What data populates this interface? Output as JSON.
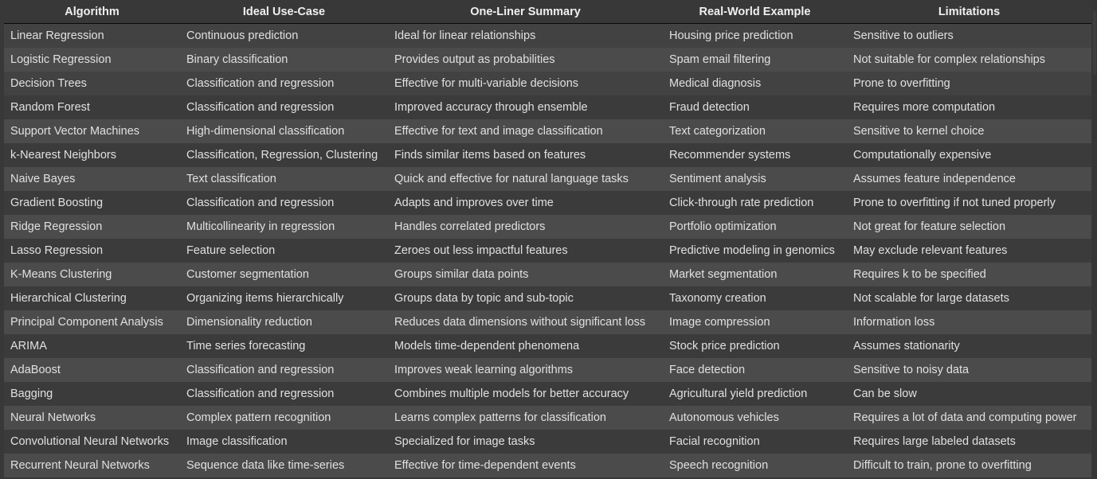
{
  "table": {
    "headers": [
      "Algorithm",
      "Ideal Use-Case",
      "One-Liner Summary",
      "Real-World Example",
      "Limitations"
    ],
    "rows": [
      [
        "Linear Regression",
        "Continuous prediction",
        "Ideal for linear relationships",
        "Housing price prediction",
        "Sensitive to outliers"
      ],
      [
        "Logistic Regression",
        "Binary classification",
        "Provides output as probabilities",
        "Spam email filtering",
        "Not suitable for complex relationships"
      ],
      [
        "Decision Trees",
        "Classification and regression",
        "Effective for multi-variable decisions",
        "Medical diagnosis",
        "Prone to overfitting"
      ],
      [
        "Random Forest",
        "Classification and regression",
        "Improved accuracy through ensemble",
        "Fraud detection",
        "Requires more computation"
      ],
      [
        "Support Vector Machines",
        "High-dimensional classification",
        "Effective for text and image classification",
        "Text categorization",
        "Sensitive to kernel choice"
      ],
      [
        "k-Nearest Neighbors",
        "Classification, Regression, Clustering",
        "Finds similar items based on features",
        "Recommender systems",
        "Computationally expensive"
      ],
      [
        "Naive Bayes",
        "Text classification",
        "Quick and effective for natural language tasks",
        "Sentiment analysis",
        "Assumes feature independence"
      ],
      [
        "Gradient Boosting",
        "Classification and regression",
        "Adapts and improves over time",
        "Click-through rate prediction",
        "Prone to overfitting if not tuned properly"
      ],
      [
        "Ridge Regression",
        "Multicollinearity in regression",
        "Handles correlated predictors",
        "Portfolio optimization",
        "Not great for feature selection"
      ],
      [
        "Lasso Regression",
        "Feature selection",
        "Zeroes out less impactful features",
        "Predictive modeling in genomics",
        "May exclude relevant features"
      ],
      [
        "K-Means Clustering",
        "Customer segmentation",
        "Groups similar data points",
        "Market segmentation",
        "Requires k to be specified"
      ],
      [
        "Hierarchical Clustering",
        "Organizing items hierarchically",
        "Groups data by topic and sub-topic",
        "Taxonomy creation",
        "Not scalable for large datasets"
      ],
      [
        "Principal Component Analysis",
        "Dimensionality reduction",
        "Reduces data dimensions without significant loss",
        "Image compression",
        "Information loss"
      ],
      [
        "ARIMA",
        "Time series forecasting",
        "Models time-dependent phenomena",
        "Stock price prediction",
        "Assumes stationarity"
      ],
      [
        "AdaBoost",
        "Classification and regression",
        "Improves weak learning algorithms",
        "Face detection",
        "Sensitive to noisy data"
      ],
      [
        "Bagging",
        "Classification and regression",
        "Combines multiple models for better accuracy",
        "Agricultural yield prediction",
        "Can be slow"
      ],
      [
        "Neural Networks",
        "Complex pattern recognition",
        "Learns complex patterns for classification",
        "Autonomous vehicles",
        "Requires a lot of data and computing power"
      ],
      [
        "Convolutional Neural Networks",
        "Image classification",
        "Specialized for image tasks",
        "Facial recognition",
        "Requires large labeled datasets"
      ],
      [
        "Recurrent Neural Networks",
        "Sequence data like time-series",
        "Effective for time-dependent events",
        "Speech recognition",
        "Difficult to train, prone to overfitting"
      ]
    ]
  }
}
